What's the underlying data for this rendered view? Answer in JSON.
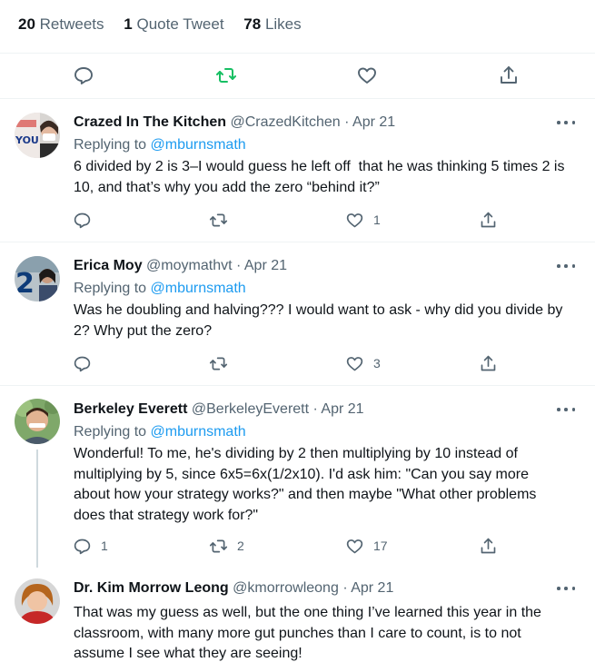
{
  "stats": {
    "retweets_count": "20",
    "retweets_label": "Retweets",
    "quotes_count": "1",
    "quotes_label": "Quote Tweet",
    "likes_count": "78",
    "likes_label": "Likes"
  },
  "icons": {
    "reply": "reply-icon",
    "retweet": "retweet-icon",
    "like": "heart-icon",
    "share": "share-icon",
    "more": "more-options-icon"
  },
  "colors": {
    "retweet_active": "#17bf63",
    "link": "#1d9bf0",
    "secondary_text": "#536471"
  },
  "replies": [
    {
      "name": "Crazed In The Kitchen",
      "handle": "@CrazedKitchen",
      "date": "Apr 21",
      "replying_label": "Replying to",
      "replying_to": "@mburnsmath",
      "text": "6 divided by 2 is 3–I would guess he left off  that he was thinking 5 times 2 is 10, and that’s why you add the zero “behind it?”",
      "replies_count": "",
      "retweets_count": "",
      "likes_count": "1",
      "avatar_text": "YOU"
    },
    {
      "name": "Erica Moy",
      "handle": "@moymathvt",
      "date": "Apr 21",
      "replying_label": "Replying to",
      "replying_to": "@mburnsmath",
      "text": "Was he doubling and halving??? I would want to ask - why did you divide by 2? Why put the zero?",
      "replies_count": "",
      "retweets_count": "",
      "likes_count": "3",
      "avatar_text": "2"
    },
    {
      "name": "Berkeley Everett",
      "handle": "@BerkeleyEverett",
      "date": "Apr 21",
      "replying_label": "Replying to",
      "replying_to": "@mburnsmath",
      "text": "Wonderful! To me, he's dividing by 2 then multiplying by 10 instead of multiplying by 5, since 6x5=6x(1/2x10). I'd ask him: \"Can you say more about how your strategy works?\" and then maybe \"What other problems does that strategy work for?\"",
      "replies_count": "1",
      "retweets_count": "2",
      "likes_count": "17"
    },
    {
      "name": "Dr. Kim Morrow Leong",
      "handle": "@kmorrowleong",
      "date": "Apr 21",
      "text": "That was my guess as well, but the one thing I’ve learned this year in the classroom, with many more gut punches than I care to count, is to not assume I see what they are seeing!"
    }
  ]
}
